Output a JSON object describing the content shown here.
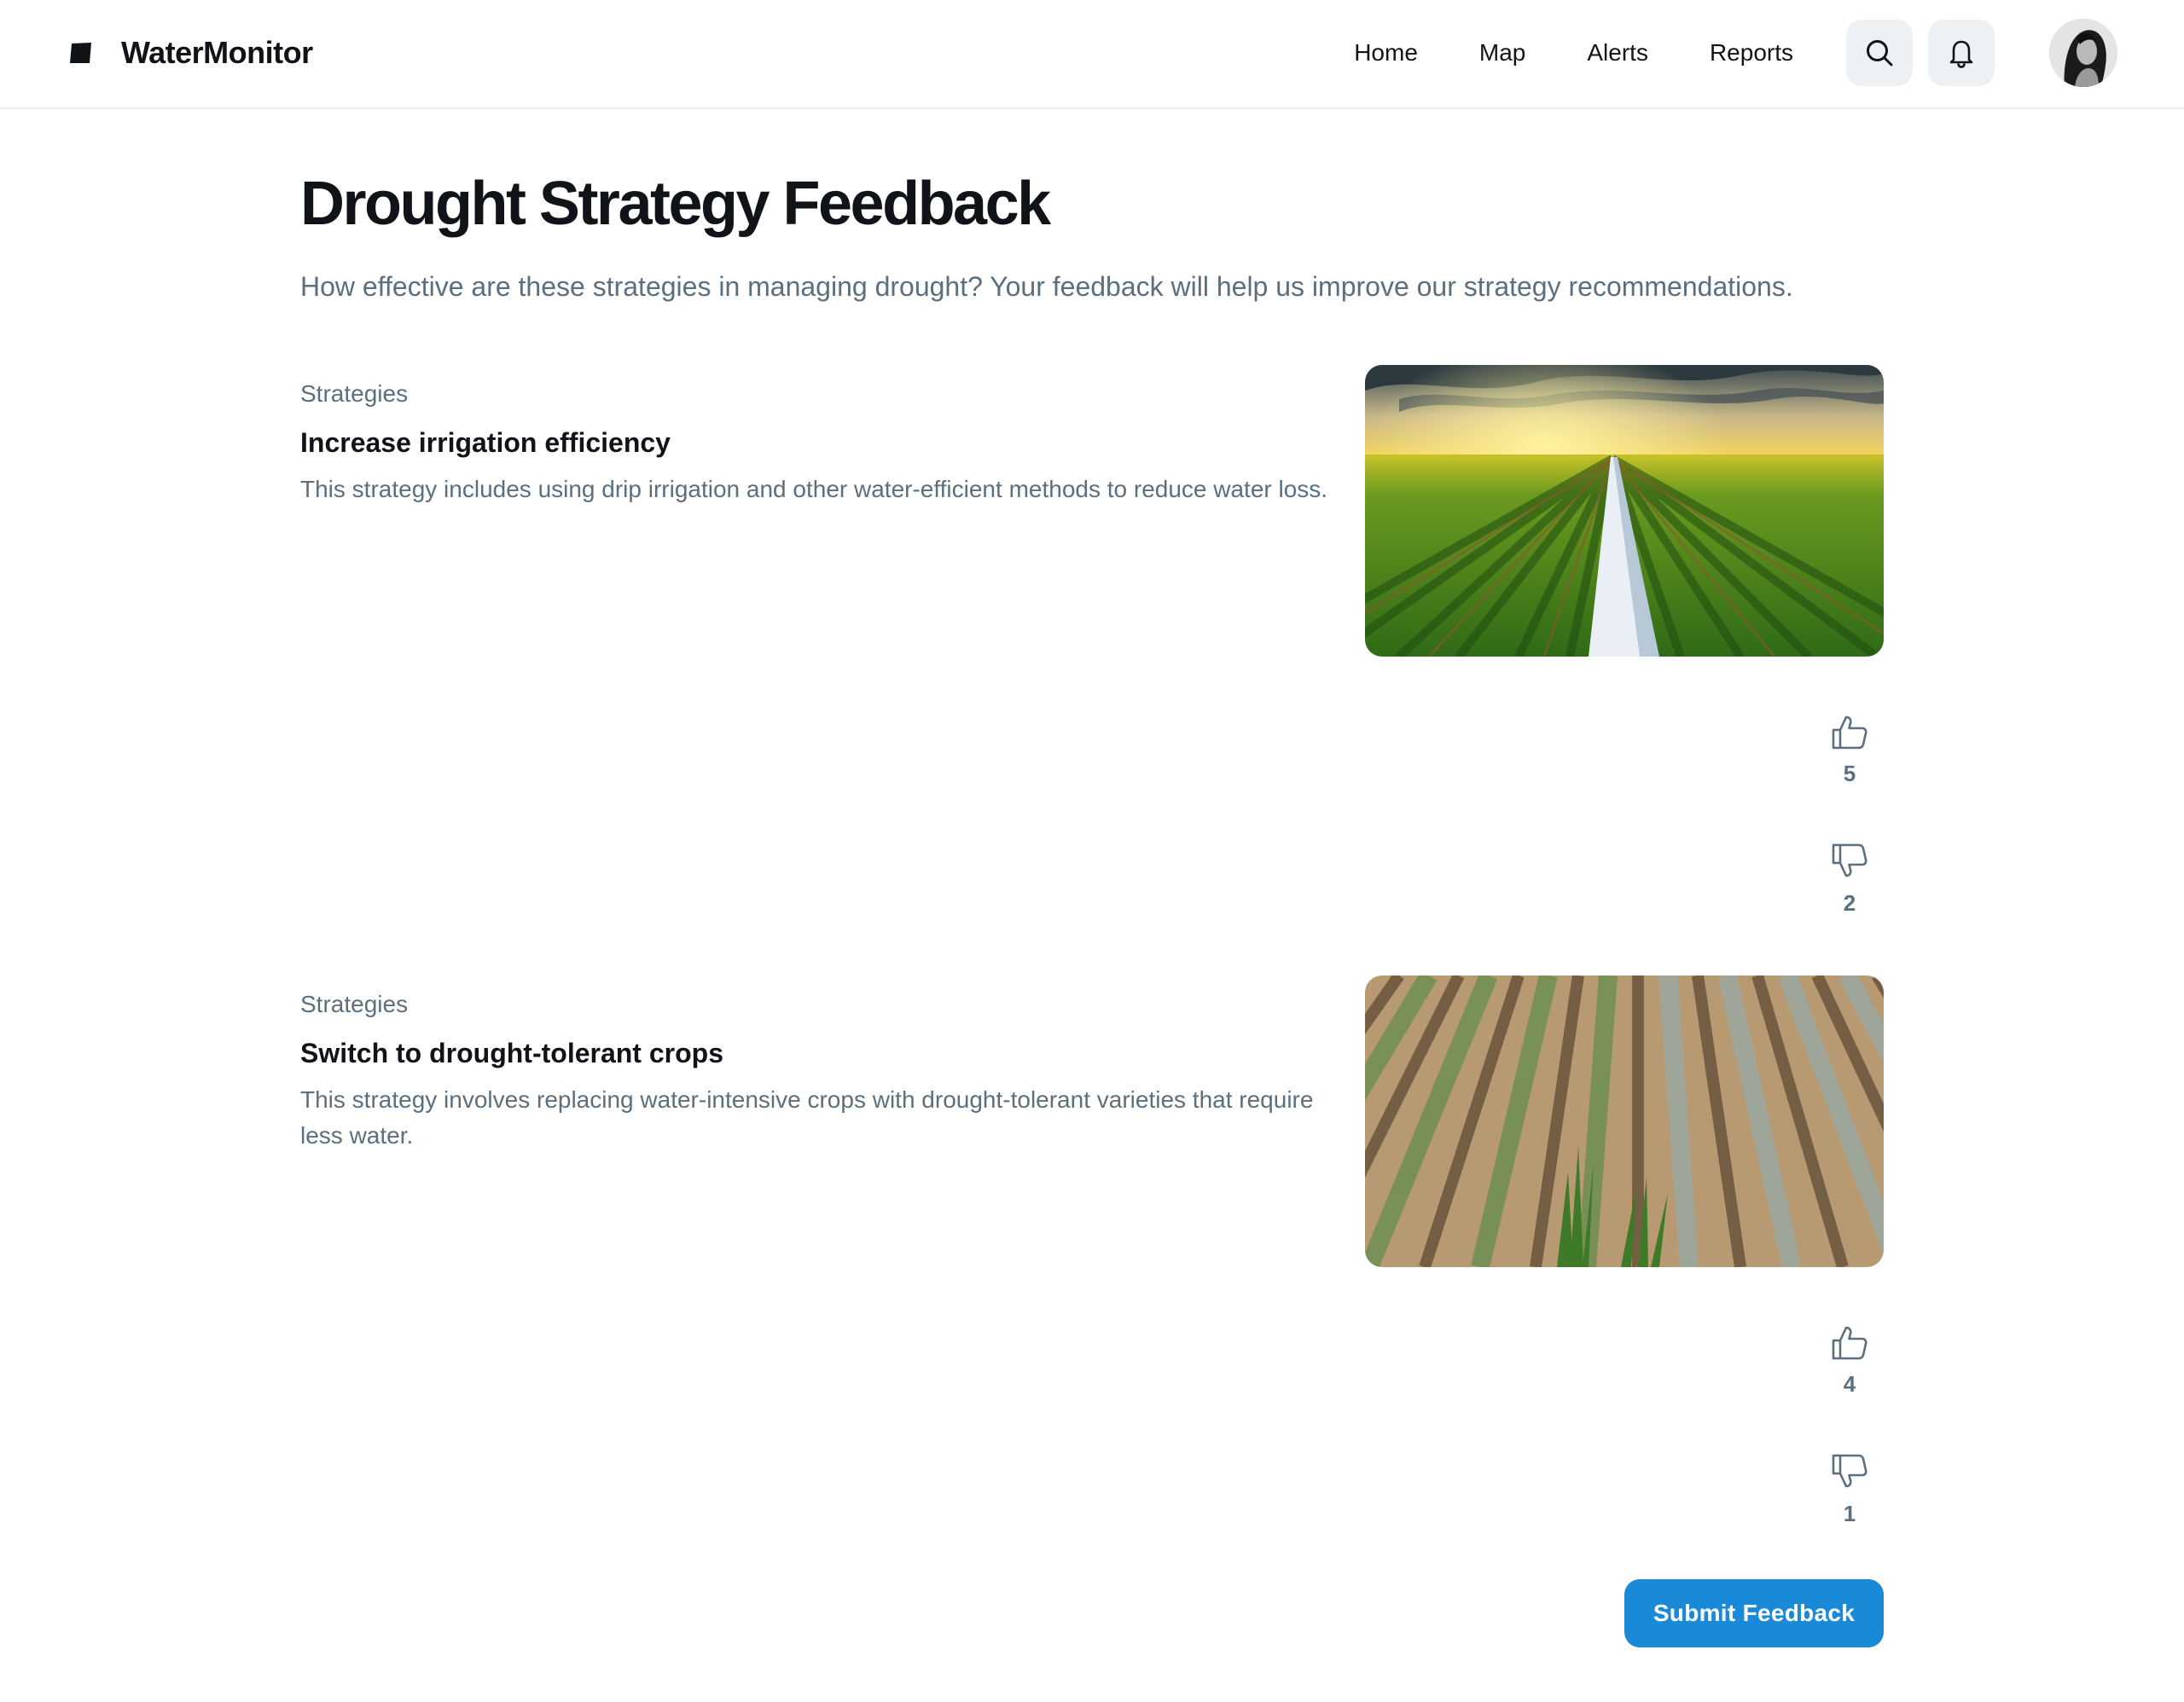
{
  "app": {
    "name": "WaterMonitor",
    "logo_icon": "watermonitor-logo-icon"
  },
  "nav": {
    "links": [
      "Home",
      "Map",
      "Alerts",
      "Reports"
    ],
    "search_icon": "search-icon",
    "notifications_icon": "bell-icon",
    "avatar_icon": "user-avatar"
  },
  "page": {
    "title": "Drought Strategy Feedback",
    "subtitle": "How effective are these strategies in managing drought? Your feedback will help us improve our strategy recommendations."
  },
  "strategies": [
    {
      "category": "Strategies",
      "title": "Increase irrigation efficiency",
      "description": "This strategy includes using drip irrigation and other water-efficient methods to reduce water loss.",
      "image": "irrigated-field-photo",
      "likes": "5",
      "dislikes": "2"
    },
    {
      "category": "Strategies",
      "title": "Switch to drought-tolerant crops",
      "description": "This strategy involves replacing water-intensive crops with drought-tolerant varieties that require less water.",
      "image": "drought-tolerant-crops-photo",
      "likes": "4",
      "dislikes": "1"
    }
  ],
  "actions": {
    "submit_label": "Submit Feedback"
  },
  "colors": {
    "accent": "#1a8ad8",
    "text_primary": "#101418",
    "text_secondary": "#5b6f7e",
    "icon_button_bg": "#eef1f4"
  }
}
